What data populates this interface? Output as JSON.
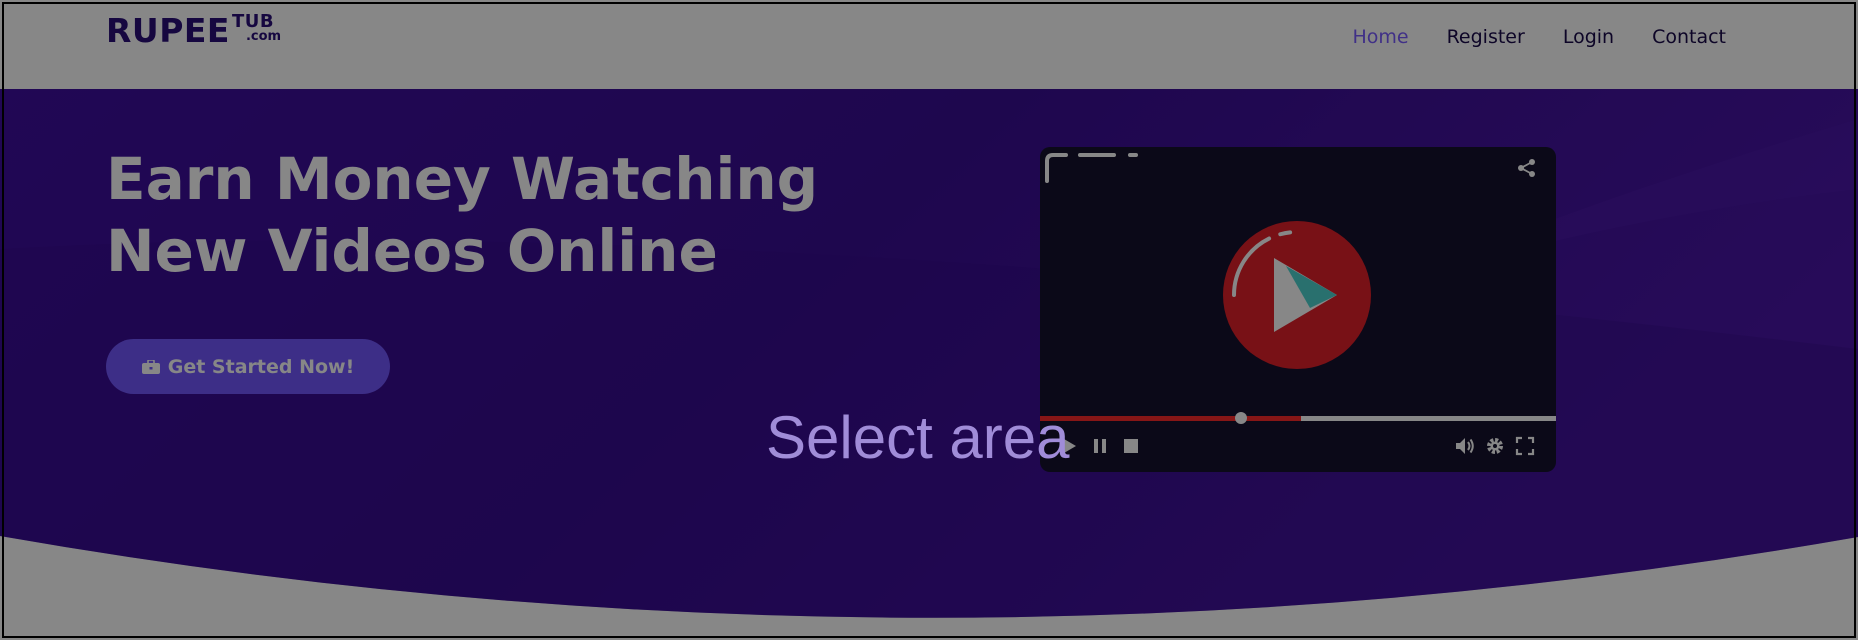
{
  "header": {
    "logo": {
      "main": "RUPEE",
      "tub": "TUB",
      "com": ".com"
    },
    "nav": [
      {
        "label": "Home",
        "active": true
      },
      {
        "label": "Register",
        "active": false
      },
      {
        "label": "Login",
        "active": false
      },
      {
        "label": "Contact",
        "active": false
      }
    ]
  },
  "hero": {
    "headline_line1": "Earn Money Watching",
    "headline_line2": "New Videos Online",
    "cta_label": "Get Started Now!",
    "cta_icon": "briefcase-icon"
  },
  "player": {
    "progress_fraction": 0.505,
    "knob_fraction": 0.39,
    "icons": [
      "share-icon",
      "play-icon",
      "pause-icon",
      "stop-icon",
      "volume-icon",
      "gear-icon",
      "fullscreen-icon"
    ]
  },
  "overlay": {
    "label": "Select area"
  },
  "colors": {
    "brand": "#2a0f7a",
    "nav_active": "#7a5cff",
    "hero_bg": "#3a0e94",
    "cta_bg": "#7358ff",
    "play_red": "#e3202b",
    "progress_red": "#ff2b2b",
    "overlay": "rgba(0,0,0,0.47)"
  }
}
